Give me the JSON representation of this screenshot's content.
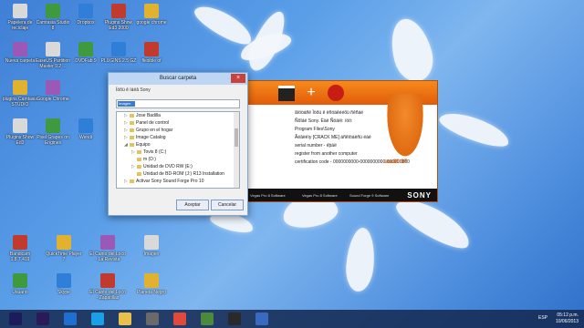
{
  "desktop_icons": [
    {
      "label": "Papelera de reciclaje",
      "col": 0,
      "row": 0
    },
    {
      "label": "Camtasia Studio 8",
      "col": 1,
      "row": 0
    },
    {
      "label": "Dropbox",
      "col": 2,
      "row": 0
    },
    {
      "label": "Plugins Show Ed3 2000",
      "col": 3,
      "row": 0
    },
    {
      "label": "google chrome",
      "col": 4,
      "row": 0
    },
    {
      "label": "Nueva carpeta",
      "col": 0,
      "row": 1
    },
    {
      "label": "EaseUS Partition Master 9.2 ...",
      "col": 1,
      "row": 1
    },
    {
      "label": "DVDFab 9",
      "col": 2,
      "row": 1
    },
    {
      "label": "PLUGINS 2.5 GZ",
      "col": 3,
      "row": 1
    },
    {
      "label": "flexible of",
      "col": 4,
      "row": 1
    },
    {
      "label": "plugins Camtasia STUDIO",
      "col": 0,
      "row": 2
    },
    {
      "label": "Google Chrome",
      "col": 1,
      "row": 2
    },
    {
      "label": "Plugins Show Ed3",
      "col": 0,
      "row": 3
    },
    {
      "label": "Pixel Grapes on Engines",
      "col": 1,
      "row": 3
    },
    {
      "label": "Wendi",
      "col": 2,
      "row": 3
    },
    {
      "label": "Bandicam 1.8.7.419",
      "col": 0,
      "row": 4
    },
    {
      "label": "QuickTime Player 7",
      "col": 1,
      "row": 4
    },
    {
      "label": "El Canto del Loco - La Revista",
      "col": 2,
      "row": 4
    },
    {
      "label": "Imagen",
      "col": 3,
      "row": 4
    },
    {
      "label": "Usuario",
      "col": 0,
      "row": 5
    },
    {
      "label": "Skype",
      "col": 1,
      "row": 5
    },
    {
      "label": "El Canto del Loco - Zapatillas",
      "col": 2,
      "row": 5
    },
    {
      "label": "Planeta Negro",
      "col": 3,
      "row": 5
    }
  ],
  "dialog": {
    "title": "Buscar carpeta",
    "close_label": "×",
    "message": "Ïöõü ê ïáëâ Sony",
    "selected_field": "Imagen",
    "tree": [
      {
        "label": "Jose Badilla",
        "indent": 1,
        "expand": "▷"
      },
      {
        "label": "Panel de control",
        "indent": 1,
        "expand": "▷"
      },
      {
        "label": "Grupo en el hogar",
        "indent": 1,
        "expand": "▷"
      },
      {
        "label": "Image Catalog",
        "indent": 1,
        "expand": "▷"
      },
      {
        "label": "Equipo",
        "indent": 1,
        "expand": "◢"
      },
      {
        "label": "Tovis 8 (C:)",
        "indent": 2,
        "expand": "▷"
      },
      {
        "label": "m (D:)",
        "indent": 2,
        "expand": ""
      },
      {
        "label": "Unidad de DVD RW (E:)",
        "indent": 2,
        "expand": "▷"
      },
      {
        "label": "Unidad de BD-ROM (J:) R13 Installation",
        "indent": 2,
        "expand": ""
      },
      {
        "label": "Activar Sony Sound Forge Pro 10",
        "indent": 1,
        "expand": "▷"
      }
    ],
    "accept_label": "Aceptar",
    "cancel_label": "Cancelar"
  },
  "vegas": {
    "lines": [
      "ãïööáñë Ïöõü ê ëñöäêééõü ñêñáë",
      "Ñôîáë Sony. Èäë Ñóáíè: ïóö:",
      "Program Files\\Sony",
      "Ãéâëëïy [CRACK ME] áñêíöáëñü ëáé",
      "serial number - éþáë",
      "register from another computer",
      "certification code - 0000000000-0000000000-000000000"
    ],
    "footer": [
      "Vegas Pro 8 Software",
      "Vegas Pro 8 Software",
      "Sound Forge 9 Software"
    ],
    "brand": "SONY",
    "badge": "ccc80 97"
  },
  "taskbar": {
    "language": "ESP",
    "time": "05:12 p.m.",
    "date": "10/06/2013",
    "apps": [
      "ae-icon",
      "pr-icon",
      "ie-icon",
      "skype-icon",
      "folder-icon",
      "files-icon",
      "chrome-icon",
      "camtasia-icon",
      "vegas-icon",
      "media-icon"
    ]
  },
  "colors": {
    "accent": "#e25c0a",
    "desktop": "#4f8fde",
    "taskbar": "#14284f"
  }
}
